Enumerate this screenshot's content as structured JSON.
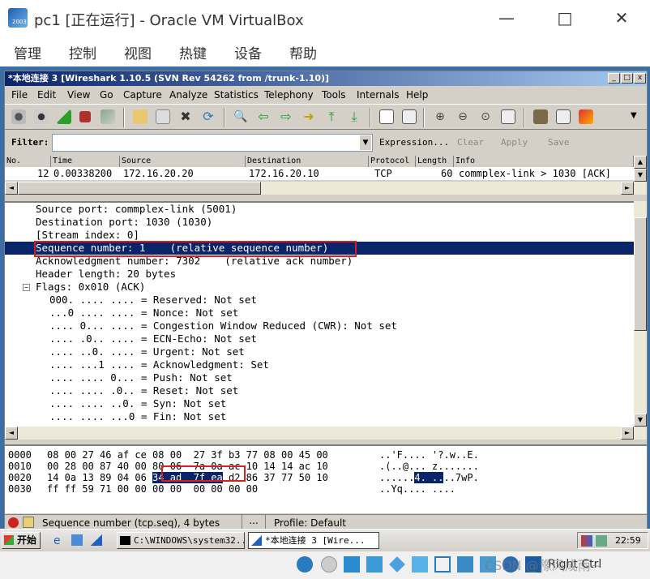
{
  "vb": {
    "title": "pc1 [正在运行] - Oracle VM VirtualBox",
    "menu": [
      "管理",
      "控制",
      "视图",
      "热键",
      "设备",
      "帮助"
    ],
    "icon_year": "2003"
  },
  "ws": {
    "title": "*本地连接 3   [Wireshark 1.10.5  (SVN Rev 54262 from /trunk-1.10)]",
    "menu": [
      "File",
      "Edit",
      "View",
      "Go",
      "Capture",
      "Analyze",
      "Statistics",
      "Telephony",
      "Tools",
      "Internals",
      "Help"
    ],
    "filter_label": "Filter:",
    "filter_value": "",
    "expression": "Expression...",
    "clear": "Clear",
    "apply": "Apply",
    "save": "Save",
    "columns": [
      "No.",
      "Time",
      "Source",
      "Destination",
      "Protocol",
      "Length",
      "Info"
    ],
    "packet": {
      "no": "12",
      "time": "0.00338200",
      "source": "172.16.20.20",
      "destination": "172.16.20.10",
      "protocol": "TCP",
      "length": "60",
      "info": "commplex-link > 1030 [ACK]"
    },
    "detail": [
      "Source port: commplex-link (5001)",
      "Destination port: 1030 (1030)",
      "[Stream index: 0]",
      "Sequence number: 1    (relative sequence number)",
      "Acknowledgment number: 7302    (relative ack number)",
      "Header length: 20 bytes",
      "Flags: 0x010 (ACK)",
      "000. .... .... = Reserved: Not set",
      "...0 .... .... = Nonce: Not set",
      ".... 0... .... = Congestion Window Reduced (CWR): Not set",
      ".... .0.. .... = ECN-Echo: Not set",
      ".... ..0. .... = Urgent: Not set",
      ".... ...1 .... = Acknowledgment: Set",
      ".... .... 0... = Push: Not set",
      ".... .... .0.. = Reset: Not set",
      ".... .... ..0. = Syn: Not set",
      ".... .... ...0 = Fin: Not set"
    ],
    "hex": [
      {
        "off": "0000",
        "bytes": "08 00 27 46 af ce 08 00  27 3f b3 77 08 00 45 00",
        "ascii": "..'F.... '?.w..E."
      },
      {
        "off": "0010",
        "bytes": "00 28 00 87 40 00 80 06  7a 0a ac 10 14 14 ac 10",
        "ascii": ".(..@... z......."
      },
      {
        "off": "0020",
        "bytes_pre": "14 0a 13 89 04 06 ",
        "bytes_hl": "34 ad  7f ea",
        "bytes_post": " d2 86 37 77 50 10",
        "ascii_pre": "......",
        "ascii_hl": "4. ..",
        "ascii_post": "..7wP."
      },
      {
        "off": "0030",
        "bytes": "ff ff 59 71 00 00 00 00  00 00 00 00",
        "ascii": "..Yq.... ...."
      }
    ],
    "status_field": "Sequence number (tcp.seq), 4 bytes",
    "status_dots": "...",
    "profile": "Profile: Default"
  },
  "taskbar": {
    "start": "开始",
    "task1": "C:\\WINDOWS\\system32...",
    "task2": "*本地连接 3   [Wire...",
    "clock": "22:59"
  },
  "vbstatus": {
    "host_key": "Right Ctrl",
    "watermark": "CSDN @豫风成雨~"
  }
}
